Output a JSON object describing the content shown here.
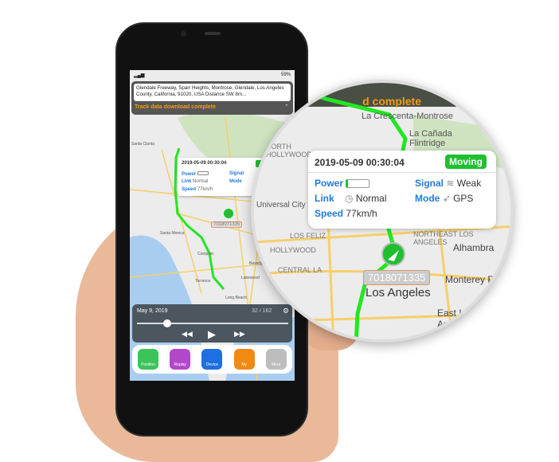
{
  "status_bar": {
    "battery": "59%"
  },
  "address": {
    "text": "Glendale Freeway, Sparr Heights, Montrose, Glendale, Los Angeles County, California, 91020, USA Distance SW 8m...",
    "notice": "Track data download complete",
    "collapse_icon": "chevron-up-icon"
  },
  "tooltip": {
    "datetime": "2019-05-09 00:30:04",
    "state": "Moving",
    "power_label": "Power",
    "link_label": "Link",
    "link_value": "Normal",
    "speed_label": "Speed",
    "speed_value": "77km/h",
    "signal_label": "Signal",
    "signal_value": "Weak",
    "mode_label": "Mode",
    "mode_value": "GPS"
  },
  "device_id": "7018071335",
  "map_labels": {
    "santa_clarita": "Santa Clarita",
    "santa_monica": "Santa Monica",
    "los_angeles": "Los Angeles",
    "long_beach": "Long Beach",
    "torrance": "Torrance",
    "compton": "Compton",
    "lakewood": "Lakewood",
    "beverly_hills": "Beverly Hills",
    "north_hollywood": "NORTH HOLLYWOOD",
    "la_crescenta": "La Crescenta-Montrose",
    "la_canada": "La Cañada Flintridge",
    "los_feliz": "LOS FELIZ",
    "hollywood": "HOLLYWOOD",
    "ne_la": "NORTHEAST LOS ANGELES",
    "alhambra": "Alhambra",
    "central_la": "CENTRAL LA",
    "monterey": "Monterey Pa",
    "east_la": "East Los Angeles",
    "universal": "Universal City"
  },
  "playback": {
    "date": "May 9, 2019",
    "counter": "32 / 162",
    "progress": 0.2
  },
  "nav": [
    {
      "label": "Position",
      "color": "#3cc35a"
    },
    {
      "label": "Replay",
      "color": "#b347c9"
    },
    {
      "label": "Device",
      "color": "#1f6fe0"
    },
    {
      "label": "My",
      "color": "#f08a12"
    },
    {
      "label": "More",
      "color": "#bdbdbd"
    }
  ],
  "colors": {
    "route": "#22e622",
    "moving": "#1fbf2f",
    "link_blue": "#1e7be0",
    "notice": "#f39c12"
  }
}
